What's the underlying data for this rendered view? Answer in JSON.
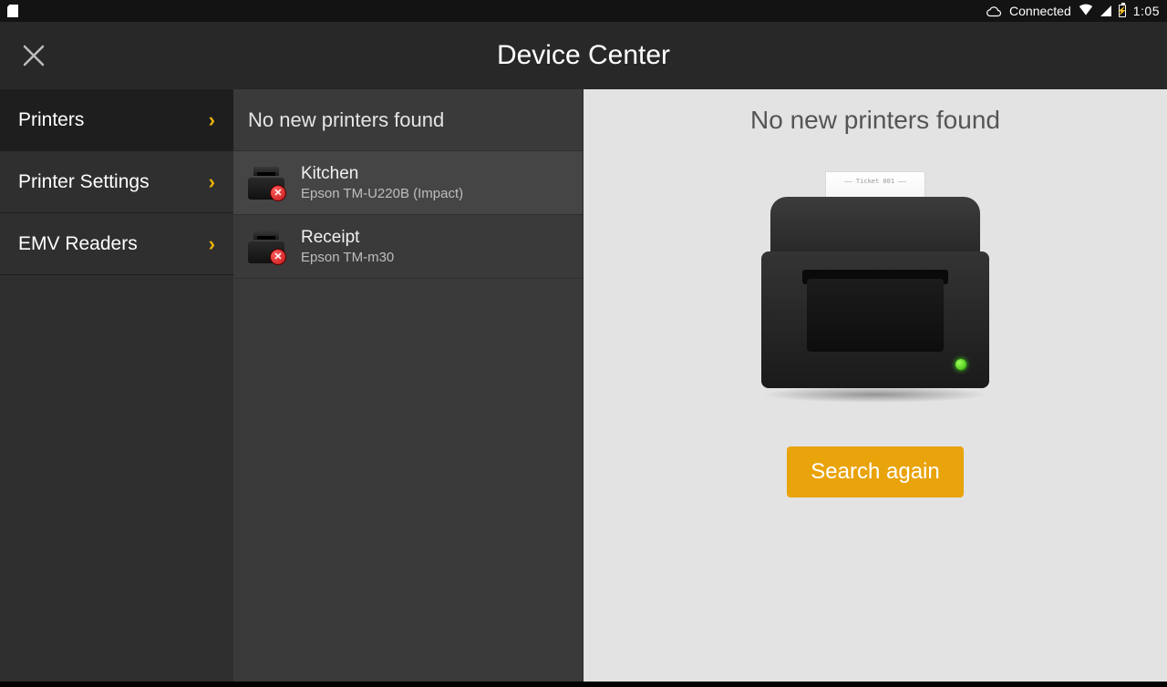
{
  "status": {
    "connection_label": "Connected",
    "time": "1:05"
  },
  "header": {
    "title": "Device Center"
  },
  "sidebar": {
    "items": [
      {
        "label": "Printers"
      },
      {
        "label": "Printer Settings"
      },
      {
        "label": "EMV Readers"
      }
    ]
  },
  "list": {
    "header": "No new printers found",
    "items": [
      {
        "name": "Kitchen",
        "model": "Epson TM-U220B (Impact)",
        "status": "error"
      },
      {
        "name": "Receipt",
        "model": "Epson TM-m30",
        "status": "error"
      }
    ]
  },
  "detail": {
    "message": "No new printers found",
    "paper_label": "—— Ticket 001 ——",
    "button_label": "Search again"
  },
  "colors": {
    "accent": "#e9a30b"
  }
}
